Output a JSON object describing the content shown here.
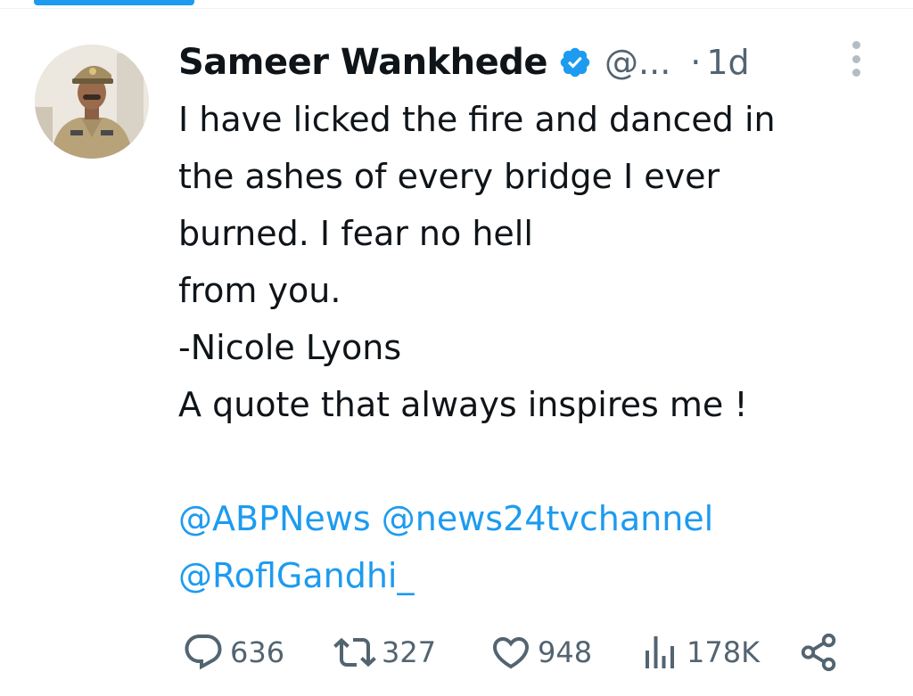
{
  "author": {
    "name": "Sameer Wankhede",
    "handle": "@...",
    "time_sep": "·",
    "time": "1d",
    "verified": true
  },
  "tweet": {
    "lines": [
      "I have licked the fire and danced in",
      "the ashes of every bridge I ever",
      "burned. I fear no hell",
      "from you.",
      "-Nicole Lyons",
      "A quote that always inspires me !"
    ],
    "mentions_line1": [
      "@ABPNews",
      "@news24tvchannel"
    ],
    "mentions_line2": [
      "@RoflGandhi_"
    ]
  },
  "actions": {
    "replies": "636",
    "retweets": "327",
    "likes": "948",
    "views": "178K"
  },
  "icons": {
    "verified": "verified-badge-icon",
    "more": "more-options-icon",
    "reply": "reply-icon",
    "retweet": "retweet-icon",
    "like": "heart-icon",
    "views": "views-icon",
    "share": "share-icon"
  },
  "colors": {
    "accent": "#1d9bf0",
    "text": "#0f1419",
    "secondary": "#536471",
    "action_icon": "#536471"
  }
}
